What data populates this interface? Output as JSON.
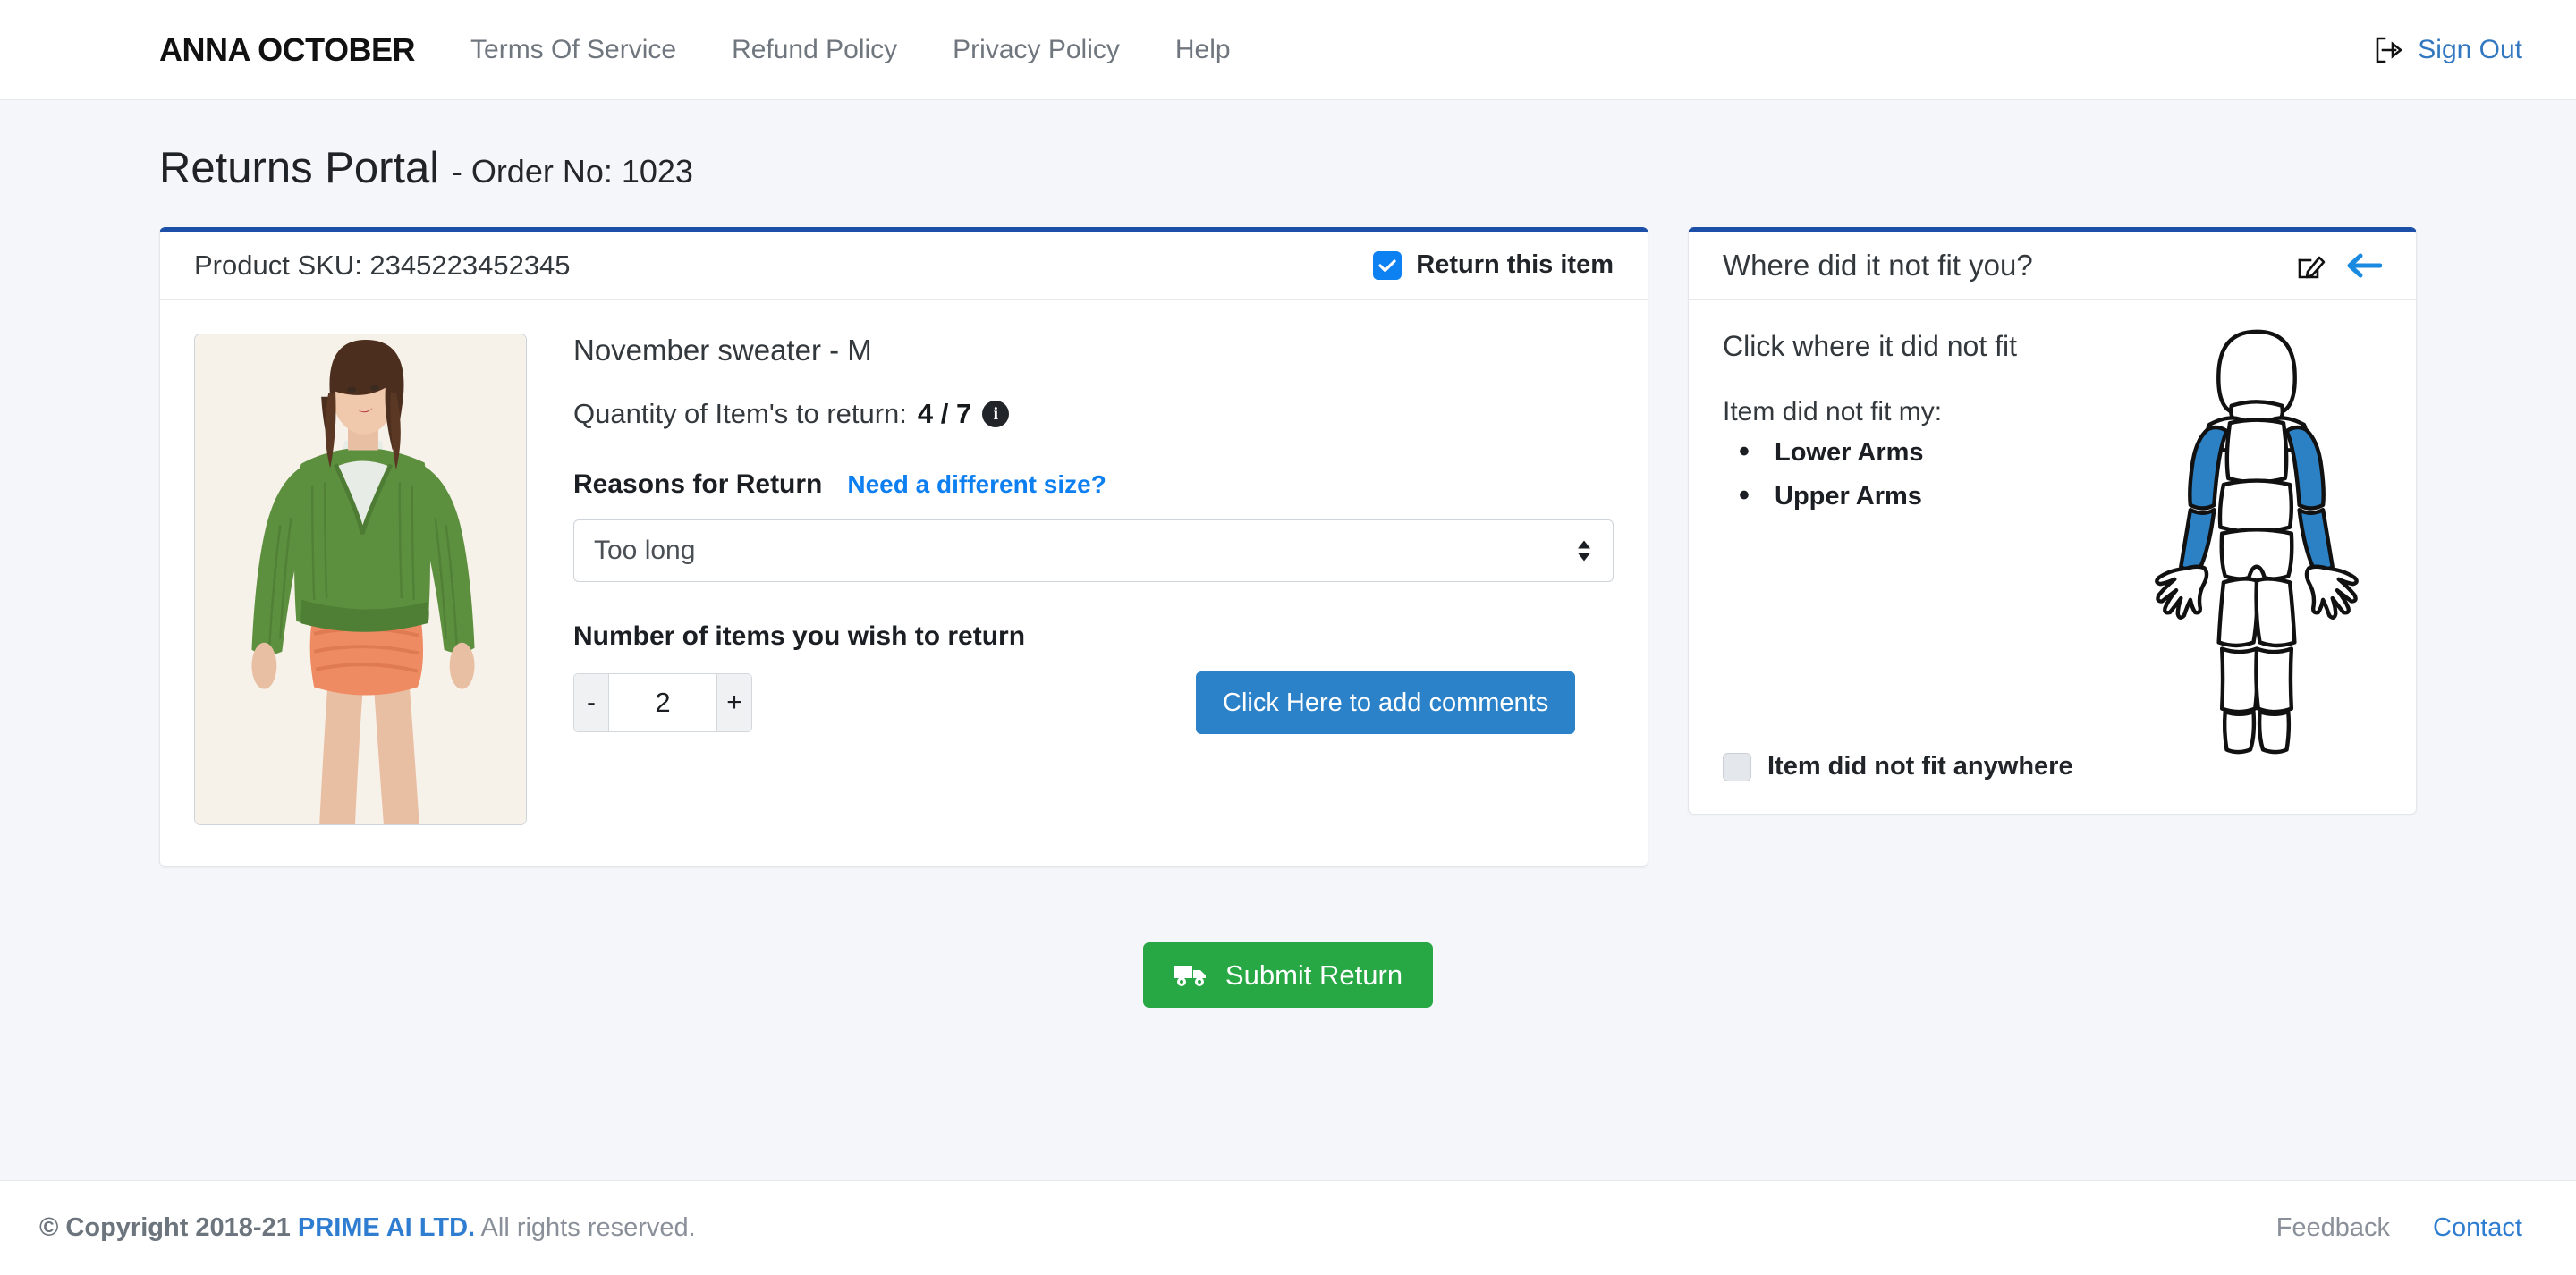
{
  "header": {
    "brand": "ANNA OCTOBER",
    "nav": [
      {
        "label": "Terms Of Service"
      },
      {
        "label": "Refund Policy"
      },
      {
        "label": "Privacy Policy"
      },
      {
        "label": "Help"
      }
    ],
    "signout_label": "Sign Out",
    "signout_icon": "sign-out-icon"
  },
  "page": {
    "title": "Returns Portal",
    "order": "- Order No: 1023"
  },
  "product_card": {
    "sku_label": "Product SKU: 2345223452345",
    "return_checkbox": {
      "label": "Return this item",
      "checked": true,
      "icon": "check-icon"
    },
    "product_name": "November sweater - M",
    "quantity_line_prefix": "Quantity of Item's to return:",
    "quantity_value": "4 / 7",
    "info_icon": "info-icon",
    "info_glyph": "i",
    "reasons_label": "Reasons for Return",
    "size_link": "Need a different size?",
    "reason_selected": "Too long",
    "reason_options": [
      "Too long"
    ],
    "number_label": "Number of items you wish to return",
    "stepper": {
      "minus": "-",
      "value": "2",
      "plus": "+"
    },
    "comments_button": "Click Here to add comments",
    "image_alt": "green-sweater-model-photo"
  },
  "fit_card": {
    "title": "Where did it not fit you?",
    "edit_icon": "edit-pencil-icon",
    "back_icon": "back-arrow-icon",
    "instruction": "Click where it did not fit",
    "subheading": "Item did not fit my:",
    "areas": [
      "Lower Arms",
      "Upper Arms"
    ],
    "anywhere_checkbox": {
      "label": "Item did not fit anywhere",
      "checked": false
    },
    "body_figure": {
      "name": "body-diagram",
      "highlighted": [
        "upper-arm-left",
        "upper-arm-right",
        "lower-arm-left",
        "lower-arm-right"
      ]
    }
  },
  "submit": {
    "label": "Submit Return",
    "icon": "truck-icon"
  },
  "footer": {
    "copyright_prefix": "© Copyright 2018-21 ",
    "copyright_brand": "PRIME AI LTD.",
    "copyright_suffix": " All rights reserved.",
    "links": [
      {
        "label": "Feedback",
        "accent": false
      },
      {
        "label": "Contact",
        "accent": true
      }
    ]
  },
  "colors": {
    "page_bg": "#f4f6f9",
    "card_top_border": "#1b4fa8",
    "accent_blue": "#0d80f2",
    "link_blue": "#2f7dd1",
    "submit_green": "#28a745",
    "comments_blue": "#2c82c9",
    "highlight_blue": "#2b81c4",
    "muted_text": "#6f767e"
  }
}
